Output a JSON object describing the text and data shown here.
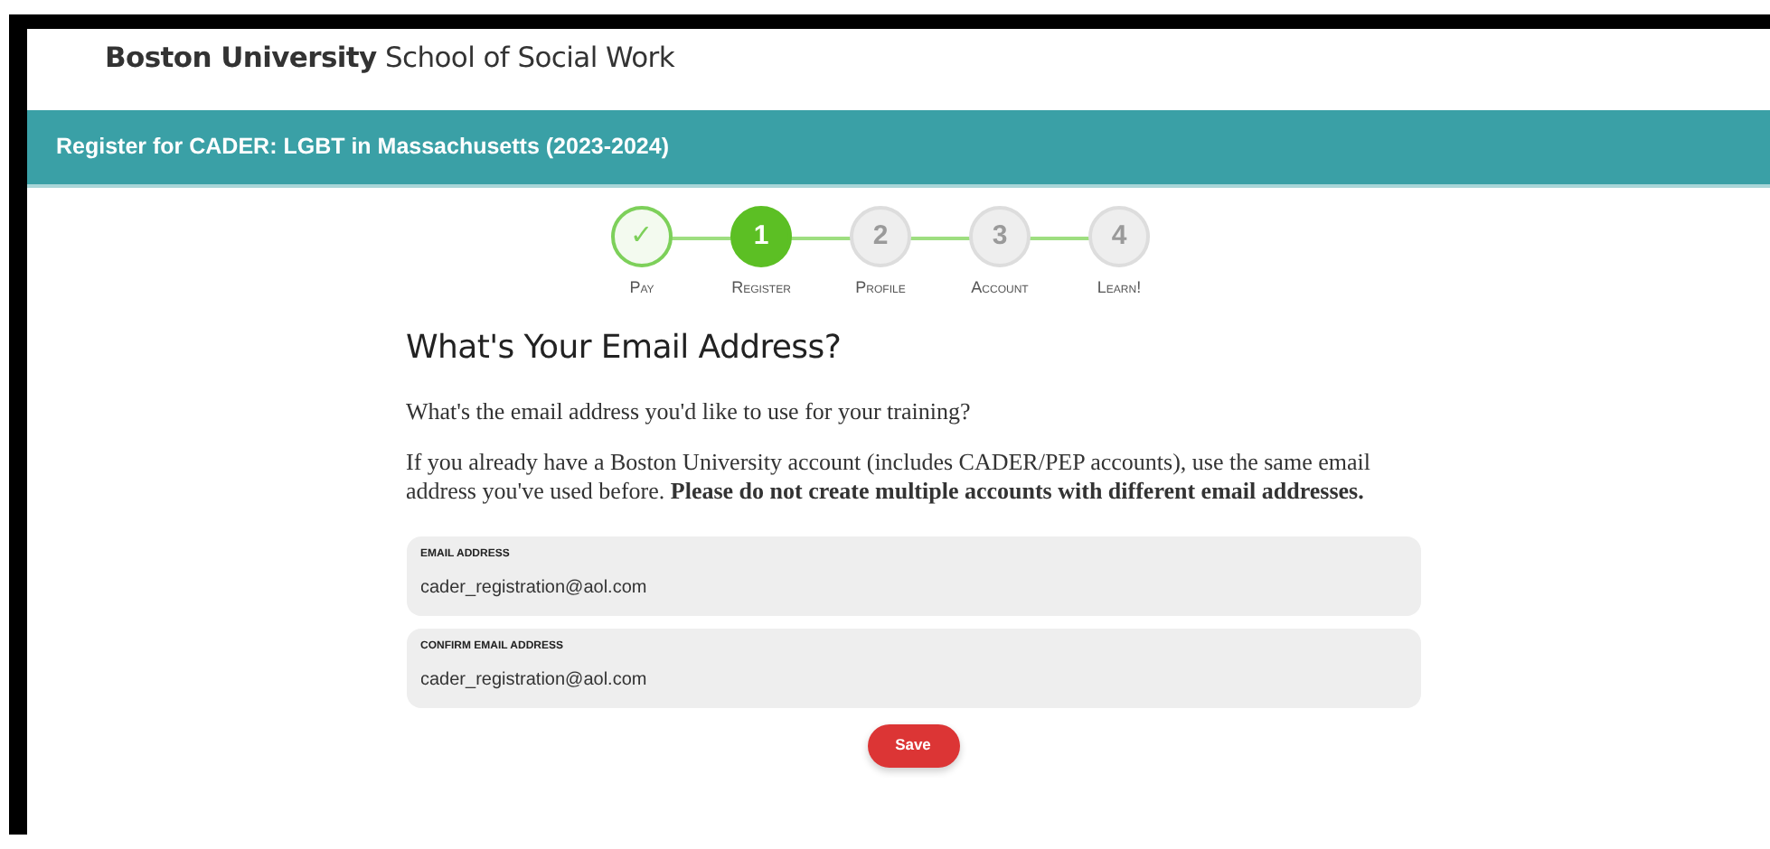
{
  "header": {
    "title": "**Boston University** School of Social Work"
  },
  "banner": {
    "title": "Register for CADER: LGBT in Massachusetts (2023-2024)"
  },
  "steps": [
    {
      "symbol": "✓",
      "label": "Pay",
      "completed": true,
      "selected": false
    },
    {
      "symbol": "1",
      "label": "Register",
      "completed": false,
      "selected": true
    },
    {
      "symbol": "2",
      "label": "Profile",
      "completed": false,
      "selected": false
    },
    {
      "symbol": "3",
      "label": "Account",
      "completed": false,
      "selected": false
    },
    {
      "symbol": "4",
      "label": "Learn!",
      "completed": false,
      "selected": false
    }
  ],
  "heading": "What's Your Email Address?",
  "paragraphs": [
    "What's the email address you'd like to use for your training?",
    "If you already have a Boston University account (includes CADER/PEP accounts), use the same email address you've used before. **Please do not create multiple accounts with different email addresses.**"
  ],
  "fields": [
    {
      "label": "EMAIL ADDRESS",
      "value": "cader_registration@aol.com"
    },
    {
      "label": "CONFIRM EMAIL ADDRESS",
      "value": "cader_registration@aol.com"
    }
  ],
  "buttons": [
    "Save"
  ]
}
